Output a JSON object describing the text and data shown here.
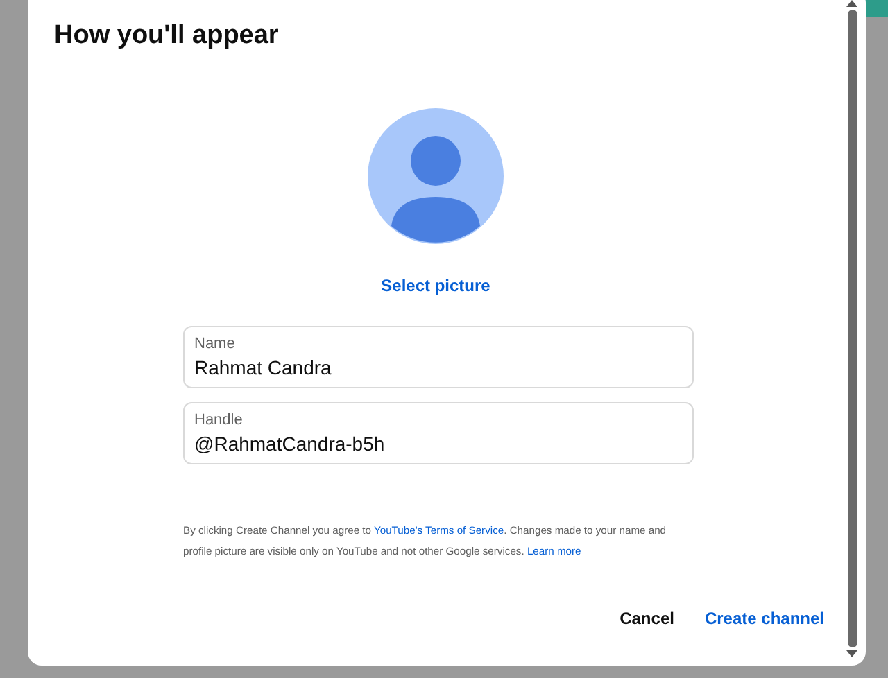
{
  "dialog": {
    "title": "How you'll appear",
    "select_picture": "Select picture",
    "fields": [
      {
        "label": "Name",
        "value": "Rahmat Candra"
      },
      {
        "label": "Handle",
        "value": "@RahmatCandra-b5h"
      }
    ],
    "notice": [
      {
        "kind": "text",
        "text": "By clicking Create Channel you agree to "
      },
      {
        "kind": "link",
        "text": "YouTube's Terms of Service"
      },
      {
        "kind": "text",
        "text": ". Changes made to your name and profile picture are visible only on YouTube and not other Google services. "
      },
      {
        "kind": "link",
        "text": "Learn more"
      }
    ],
    "buttons": [
      {
        "kind": "plain",
        "label": "Cancel"
      },
      {
        "kind": "primary",
        "label": "Create channel"
      }
    ]
  }
}
